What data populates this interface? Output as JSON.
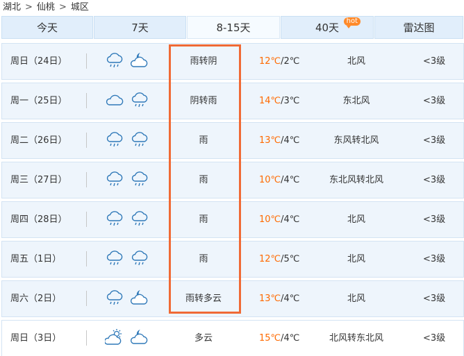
{
  "breadcrumb": [
    {
      "label": "湖北"
    },
    {
      "label": "仙桃"
    },
    {
      "label": "城区"
    }
  ],
  "breadcrumb_separator": ">",
  "tabs": [
    {
      "label": "今天",
      "active": false
    },
    {
      "label": "7天",
      "active": false
    },
    {
      "label": "8-15天",
      "active": true
    },
    {
      "label": "40天",
      "active": false,
      "badge": "hot"
    },
    {
      "label": "雷达图",
      "active": false
    }
  ],
  "forecast": [
    {
      "day": "周日（24日）",
      "icons": [
        "rain-cloud-icon",
        "moon-cloud-icon"
      ],
      "weather": "雨转阴",
      "temp_high": "12℃",
      "temp_low": "/2℃",
      "wind": "北风",
      "level": "<3级",
      "highlighted": true
    },
    {
      "day": "周一（25日）",
      "icons": [
        "cloud-icon",
        "rain-cloud-icon"
      ],
      "weather": "阴转雨",
      "temp_high": "14℃",
      "temp_low": "/3℃",
      "wind": "东北风",
      "level": "<3级",
      "highlighted": true
    },
    {
      "day": "周二（26日）",
      "icons": [
        "rain-cloud-icon",
        "rain-cloud-icon"
      ],
      "weather": "雨",
      "temp_high": "13℃",
      "temp_low": "/4℃",
      "wind": "东风转北风",
      "level": "<3级",
      "highlighted": true
    },
    {
      "day": "周三（27日）",
      "icons": [
        "rain-cloud-icon",
        "rain-cloud-icon"
      ],
      "weather": "雨",
      "temp_high": "10℃",
      "temp_low": "/4℃",
      "wind": "东北风转北风",
      "level": "<3级",
      "highlighted": true
    },
    {
      "day": "周四（28日）",
      "icons": [
        "rain-cloud-icon",
        "rain-cloud-icon"
      ],
      "weather": "雨",
      "temp_high": "10℃",
      "temp_low": "/4℃",
      "wind": "北风",
      "level": "<3级",
      "highlighted": true
    },
    {
      "day": "周五（1日）",
      "icons": [
        "rain-cloud-icon",
        "rain-cloud-icon"
      ],
      "weather": "雨",
      "temp_high": "12℃",
      "temp_low": "/5℃",
      "wind": "北风",
      "level": "<3级",
      "highlighted": true
    },
    {
      "day": "周六（2日）",
      "icons": [
        "rain-cloud-icon",
        "moon-cloud-icon"
      ],
      "weather": "雨转多云",
      "temp_high": "13℃",
      "temp_low": "/4℃",
      "wind": "北风",
      "level": "<3级",
      "highlighted": true
    },
    {
      "day": "周日（3日）",
      "icons": [
        "sun-cloud-icon",
        "moon-cloud-icon"
      ],
      "weather": "多云",
      "temp_high": "15℃",
      "temp_low": "/4℃",
      "wind": "北风转东北风",
      "level": "<3级",
      "highlighted": false
    }
  ],
  "colors": {
    "temp_high": "#ff6a00",
    "highlight_border": "#f06a35",
    "row_bg": "#eef5fc",
    "tab_bg": "#e1eefb",
    "icon_stroke": "#2e78b8",
    "hot_badge": "#ff8a2a"
  }
}
